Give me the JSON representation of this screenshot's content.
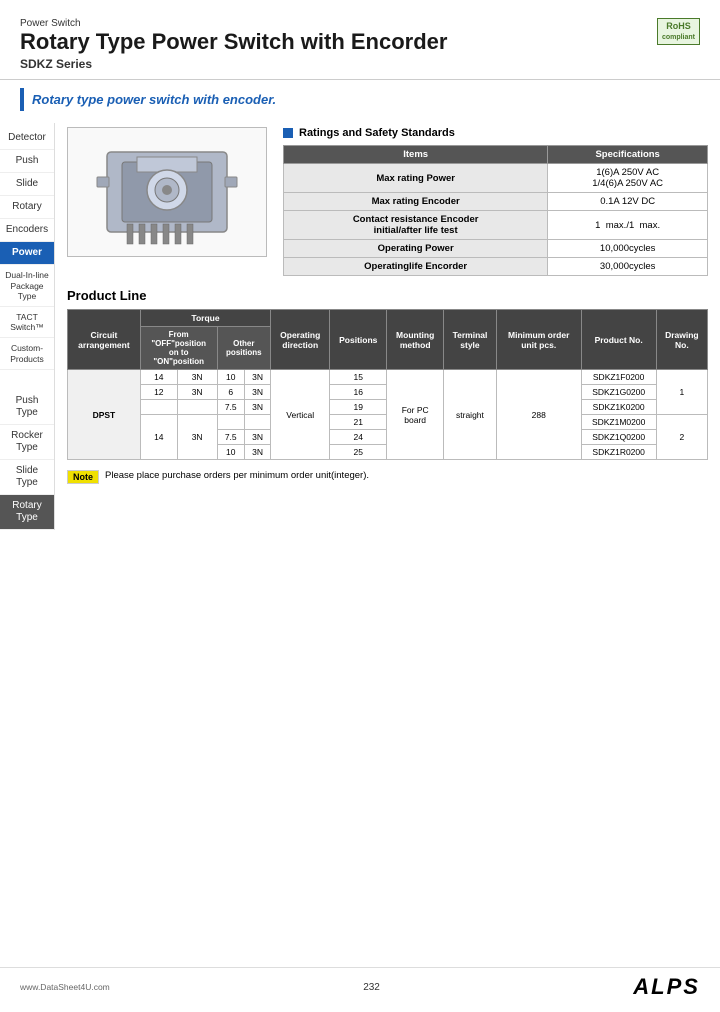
{
  "header": {
    "subtitle": "Power Switch",
    "title": "Rotary Type Power Switch with Encorder",
    "series": "SDKZ Series",
    "rohs": "RoHS\ncompliant"
  },
  "tagline": "Rotary type power switch with encoder.",
  "sidebar": {
    "items": [
      {
        "label": "Detector",
        "state": "normal"
      },
      {
        "label": "Push",
        "state": "normal"
      },
      {
        "label": "Slide",
        "state": "normal"
      },
      {
        "label": "Rotary",
        "state": "normal"
      },
      {
        "label": "Encoders",
        "state": "normal"
      },
      {
        "label": "Power",
        "state": "active-blue"
      },
      {
        "label": "Dual-In-line Package Type",
        "state": "normal",
        "small": true
      },
      {
        "label": "TACT Switch™",
        "state": "normal"
      },
      {
        "label": "Custom-Products",
        "state": "normal"
      },
      {
        "label": "Push Type",
        "state": "normal"
      },
      {
        "label": "Rocker Type",
        "state": "normal"
      },
      {
        "label": "Slide Type",
        "state": "normal"
      },
      {
        "label": "Rotary Type",
        "state": "active-dark"
      }
    ]
  },
  "ratings": {
    "title": "Ratings and Safety Standards",
    "table": {
      "headers": [
        "Items",
        "Specifications"
      ],
      "rows": [
        {
          "item": "Max rating  Power",
          "spec": "1(6)A 250V AC\n1/4(6)A 250V AC"
        },
        {
          "item": "Max rating  Encoder",
          "spec": "0.1A 12V DC"
        },
        {
          "item": "Contact resistance  Encoder\ninitial/after life test",
          "spec": "1　max./1　max."
        },
        {
          "item": "Operating  Power",
          "spec": "10,000cycles"
        },
        {
          "item": "Operatinglife  Encorder",
          "spec": "30,000cycles"
        }
      ]
    }
  },
  "product_line": {
    "title": "Product Line",
    "table": {
      "headers": {
        "torque_group": "Torque",
        "cols": [
          "Circuit arrangement",
          "From \"OFF\"position on to \"ON\"position",
          "Other positions",
          "Operating direction",
          "Positions",
          "Mounting method",
          "Terminal style",
          "Minimum order unit  pcs.",
          "Product No.",
          "Drawing No."
        ]
      },
      "rows": [
        {
          "circuit": "DPST",
          "from_off_val": "14",
          "from_off_unit": "3N",
          "other_val": "10",
          "other_unit": "3N",
          "position": "15",
          "mounting": "For PC board",
          "terminal": "straight",
          "min_order": "288",
          "product_no": "SDKZ1F0200",
          "drawing": "1"
        },
        {
          "circuit": "",
          "from_off_val": "12",
          "from_off_unit": "3N",
          "other_val": "6",
          "other_unit": "3N",
          "position": "16",
          "mounting": "",
          "terminal": "",
          "min_order": "",
          "product_no": "SDKZ1G0200",
          "drawing": ""
        },
        {
          "circuit": "",
          "from_off_val": "",
          "from_off_unit": "",
          "other_val": "7.5",
          "other_unit": "3N",
          "position": "19",
          "mounting": "",
          "terminal": "",
          "min_order": "",
          "product_no": "SDKZ1K0200",
          "drawing": ""
        },
        {
          "circuit": "",
          "from_off_val": "14",
          "from_off_unit": "3N",
          "other_val": "",
          "other_unit": "",
          "position": "21",
          "mounting": "",
          "terminal": "",
          "min_order": "",
          "product_no": "SDKZ1M0200",
          "drawing": "2"
        },
        {
          "circuit": "",
          "from_off_val": "",
          "from_off_unit": "",
          "other_val": "7.5",
          "other_unit": "3N",
          "position": "24",
          "mounting": "",
          "terminal": "",
          "min_order": "",
          "product_no": "SDKZ1Q0200",
          "drawing": ""
        },
        {
          "circuit": "",
          "from_off_val": "",
          "from_off_unit": "",
          "other_val": "10",
          "other_unit": "3N",
          "position": "25",
          "mounting": "",
          "terminal": "",
          "min_order": "",
          "product_no": "SDKZ1R0200",
          "drawing": ""
        }
      ]
    }
  },
  "note": {
    "label": "Note",
    "text": "Please place purchase orders per minimum order unit(integer)."
  },
  "footer": {
    "url": "www.DataSheet4U.com",
    "page": "232",
    "brand": "ALPS"
  }
}
